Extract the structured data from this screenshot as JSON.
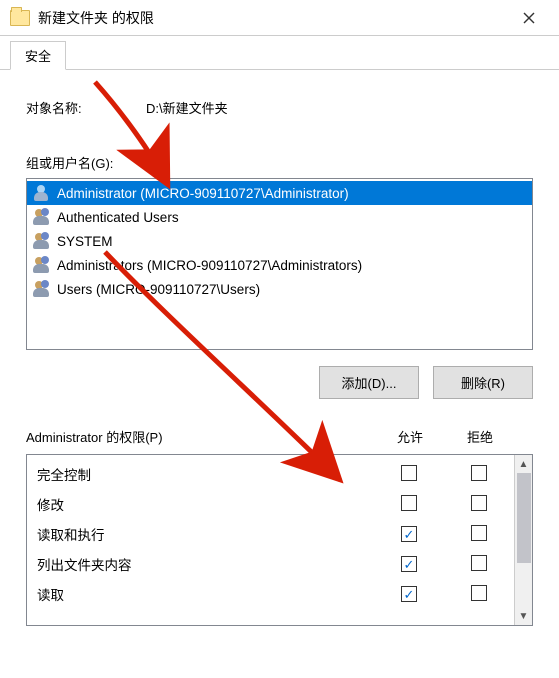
{
  "window": {
    "title": "新建文件夹 的权限"
  },
  "tab": {
    "security": "安全"
  },
  "object": {
    "label": "对象名称:",
    "value": "D:\\新建文件夹"
  },
  "groups": {
    "label": "组或用户名(G):",
    "items": [
      {
        "name": "Administrator (MICRO-909110727\\Administrator)",
        "type": "user",
        "selected": true
      },
      {
        "name": "Authenticated Users",
        "type": "group",
        "selected": false
      },
      {
        "name": "SYSTEM",
        "type": "group",
        "selected": false
      },
      {
        "name": "Administrators (MICRO-909110727\\Administrators)",
        "type": "group",
        "selected": false
      },
      {
        "name": "Users (MICRO-909110727\\Users)",
        "type": "group",
        "selected": false
      }
    ]
  },
  "buttons": {
    "add": "添加(D)...",
    "remove": "删除(R)"
  },
  "perm": {
    "label": "Administrator 的权限(P)",
    "allow": "允许",
    "deny": "拒绝",
    "rows": [
      {
        "name": "完全控制",
        "allow": false,
        "deny": false
      },
      {
        "name": "修改",
        "allow": false,
        "deny": false
      },
      {
        "name": "读取和执行",
        "allow": true,
        "deny": false
      },
      {
        "name": "列出文件夹内容",
        "allow": true,
        "deny": false
      },
      {
        "name": "读取",
        "allow": true,
        "deny": false
      }
    ]
  },
  "annotation": {
    "color": "#d81e06"
  }
}
